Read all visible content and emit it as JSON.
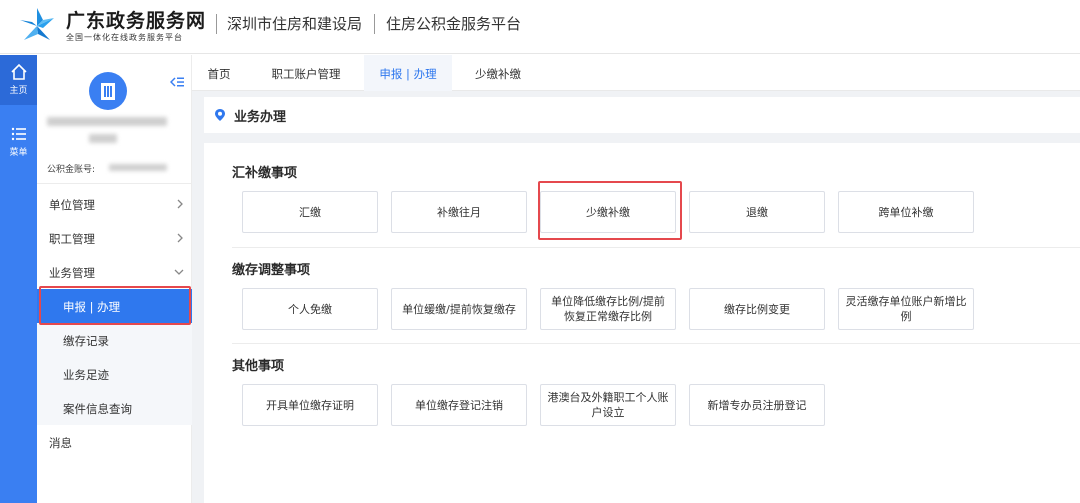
{
  "header": {
    "brand_title": "广东政务服务网",
    "brand_subtitle": "全国一体化在线政务服务平台",
    "org": "深圳市住房和建设局",
    "platform": "住房公积金服务平台"
  },
  "rail": [
    {
      "label": "主页",
      "icon": "home-icon"
    },
    {
      "label": "菜单",
      "icon": "menu-list-icon"
    }
  ],
  "side": {
    "account_label": "公积金账号:",
    "menu": [
      {
        "label": "单位管理",
        "icon": "chevron-right-icon"
      },
      {
        "label": "职工管理",
        "icon": "chevron-right-icon"
      },
      {
        "label": "业务管理",
        "icon": "chevron-down-icon"
      }
    ],
    "submenu": [
      "申报 | 办理",
      "缴存记录",
      "业务足迹",
      "案件信息查询"
    ],
    "message": "消息"
  },
  "tabs": [
    "首页",
    "职工账户管理",
    "申报 | 办理",
    "少缴补缴"
  ],
  "section_title": "业务办理",
  "groups": [
    {
      "title": "汇补缴事项",
      "items": [
        "汇缴",
        "补缴往月",
        "少缴补缴",
        "退缴",
        "跨单位补缴"
      ]
    },
    {
      "title": "缴存调整事项",
      "items": [
        "个人免缴",
        "单位缓缴/提前恢复缴存",
        "单位降低缴存比例/提前恢复正常缴存比例",
        "缴存比例变更",
        "灵活缴存单位账户新增比例"
      ]
    },
    {
      "title": "其他事项",
      "items": [
        "开具单位缴存证明",
        "单位缴存登记注销",
        "港澳台及外籍职工个人账户设立",
        "新增专办员注册登记"
      ]
    }
  ],
  "colors": {
    "accent": "#2f78ee",
    "highlight": "#e5484d"
  }
}
